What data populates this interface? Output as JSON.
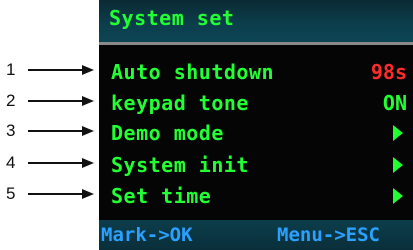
{
  "callouts": [
    "1",
    "2",
    "3",
    "4",
    "5"
  ],
  "screen": {
    "title": "System set",
    "items": [
      {
        "label": "Auto shutdown",
        "value": "98s",
        "value_color": "#ff2a2a"
      },
      {
        "label": "keypad tone",
        "value": "ON",
        "value_color": "#22ff33"
      },
      {
        "label": "Demo mode",
        "icon": "triangle-right-icon"
      },
      {
        "label": "System init",
        "icon": "triangle-right-icon"
      },
      {
        "label": "Set time",
        "icon": "triangle-right-icon"
      }
    ],
    "footer": {
      "left": "Mark->OK",
      "right": "Menu->ESC"
    }
  },
  "colors": {
    "text_primary": "#22ff33",
    "value_red": "#ff2a2a",
    "footer_text": "#2aa0ff",
    "background": "#050505"
  }
}
